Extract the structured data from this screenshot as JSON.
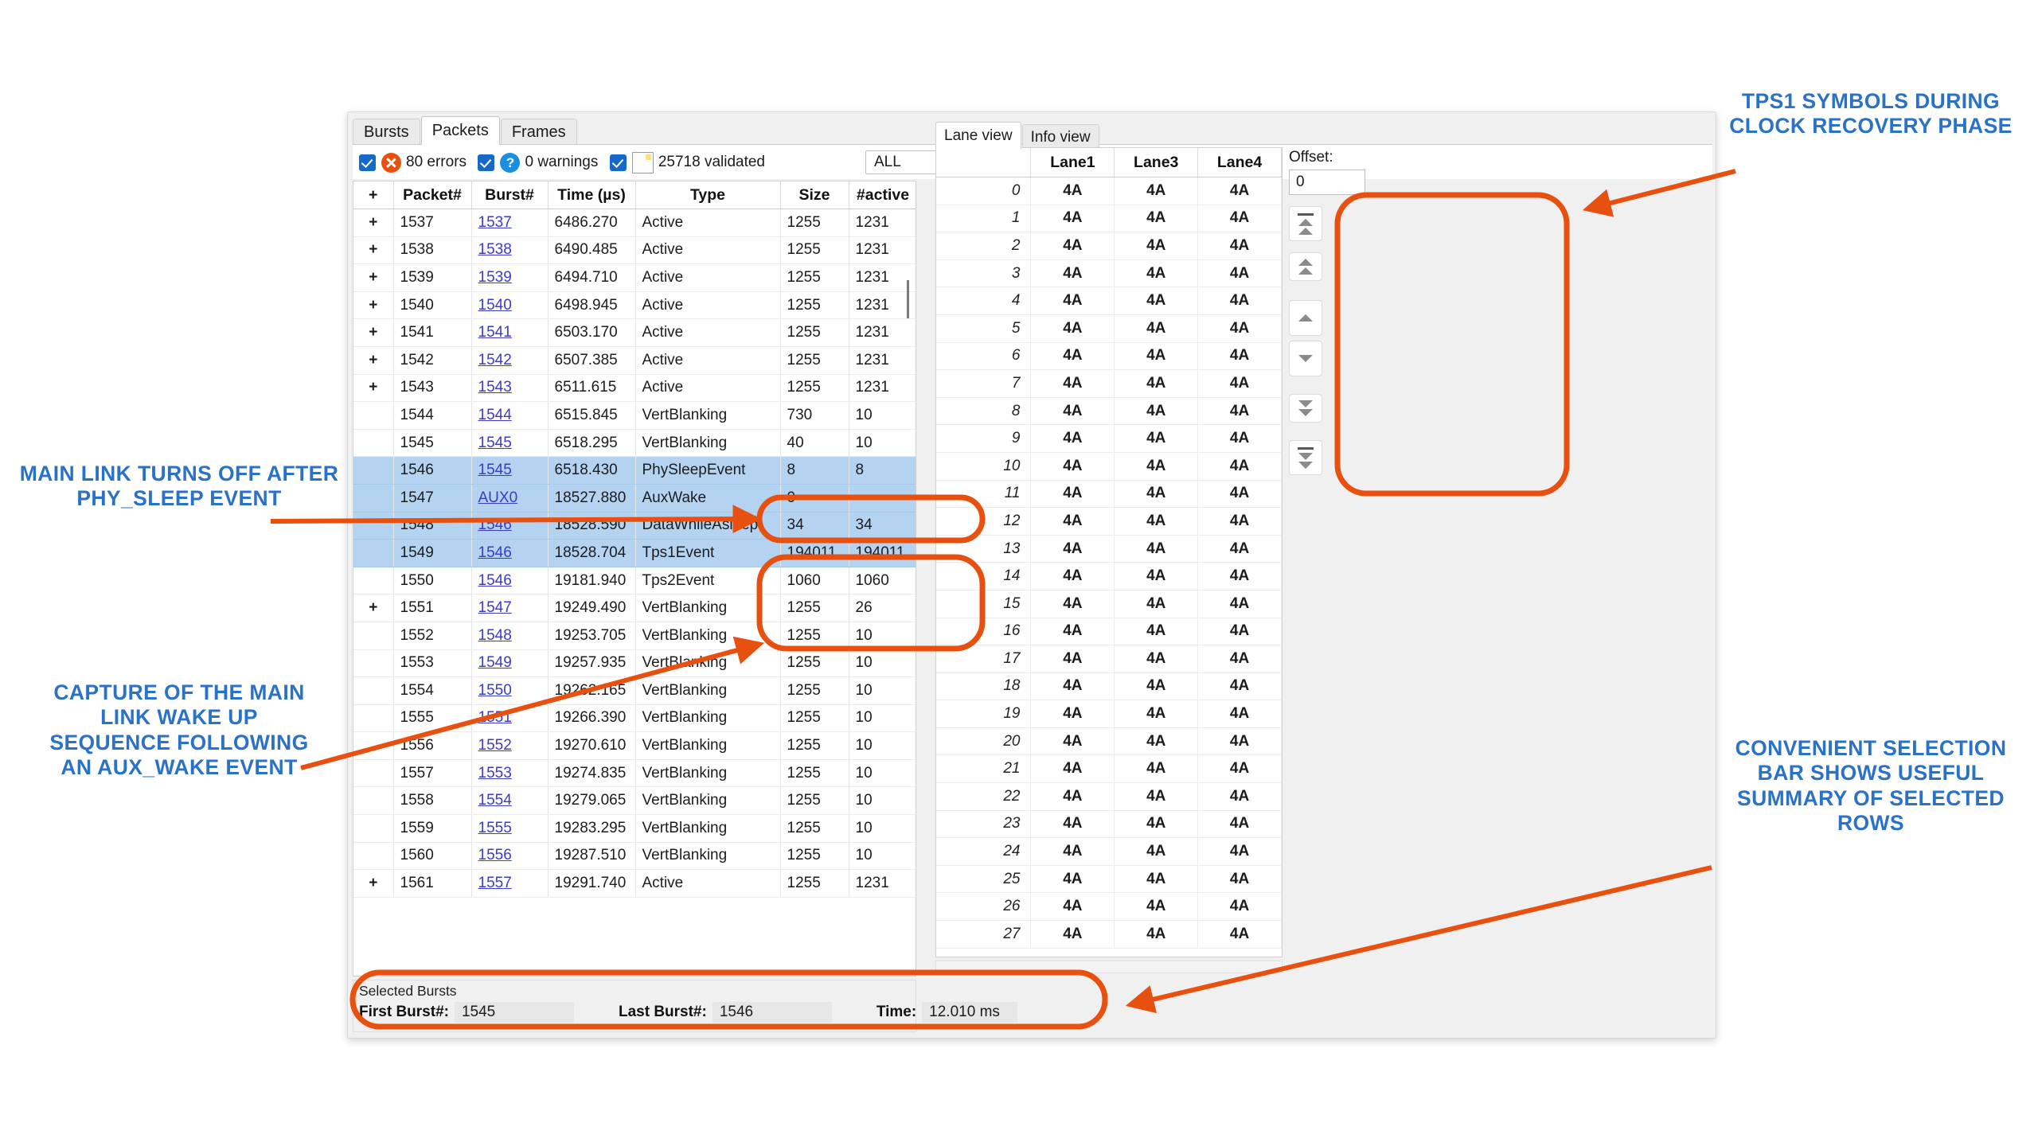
{
  "window": {
    "tabs": [
      {
        "label": "Bursts",
        "active": false
      },
      {
        "label": "Packets",
        "active": true
      },
      {
        "label": "Frames",
        "active": false
      }
    ]
  },
  "filter_bar": {
    "errors": {
      "label": "80 errors",
      "checked": true,
      "icon": "error-icon"
    },
    "warnings": {
      "label": "0 warnings",
      "checked": true,
      "icon": "question-icon"
    },
    "validated": {
      "label": "25718 validated",
      "checked": true,
      "icon": "note-icon"
    },
    "dropdown": {
      "value": "ALL"
    }
  },
  "packets_table": {
    "columns": [
      "+",
      "Packet#",
      "Burst#",
      "Time (µs)",
      "Type",
      "Size",
      "#active"
    ],
    "rows": [
      {
        "plus": "+",
        "packet": "1537",
        "burst": "1537",
        "time": "6486.270",
        "type": "Active",
        "size": "1255",
        "active": "1231",
        "selected": false
      },
      {
        "plus": "+",
        "packet": "1538",
        "burst": "1538",
        "time": "6490.485",
        "type": "Active",
        "size": "1255",
        "active": "1231",
        "selected": false
      },
      {
        "plus": "+",
        "packet": "1539",
        "burst": "1539",
        "time": "6494.710",
        "type": "Active",
        "size": "1255",
        "active": "1231",
        "selected": false
      },
      {
        "plus": "+",
        "packet": "1540",
        "burst": "1540",
        "time": "6498.945",
        "type": "Active",
        "size": "1255",
        "active": "1231",
        "selected": false
      },
      {
        "plus": "+",
        "packet": "1541",
        "burst": "1541",
        "time": "6503.170",
        "type": "Active",
        "size": "1255",
        "active": "1231",
        "selected": false
      },
      {
        "plus": "+",
        "packet": "1542",
        "burst": "1542",
        "time": "6507.385",
        "type": "Active",
        "size": "1255",
        "active": "1231",
        "selected": false
      },
      {
        "plus": "+",
        "packet": "1543",
        "burst": "1543",
        "time": "6511.615",
        "type": "Active",
        "size": "1255",
        "active": "1231",
        "selected": false
      },
      {
        "plus": "",
        "packet": "1544",
        "burst": "1544",
        "time": "6515.845",
        "type": "VertBlanking",
        "size": "730",
        "active": "10",
        "selected": false
      },
      {
        "plus": "",
        "packet": "1545",
        "burst": "1545",
        "time": "6518.295",
        "type": "VertBlanking",
        "size": "40",
        "active": "10",
        "selected": false
      },
      {
        "plus": "",
        "packet": "1546",
        "burst": "1545",
        "time": "6518.430",
        "type": "PhySleepEvent",
        "size": "8",
        "active": "8",
        "selected": true
      },
      {
        "plus": "",
        "packet": "1547",
        "burst": "AUX0",
        "time": "18527.880",
        "type": "AuxWake",
        "size": "0",
        "active": "",
        "selected": true
      },
      {
        "plus": "",
        "packet": "1548",
        "burst": "1546",
        "time": "18528.590",
        "type": "DataWhileAsleep",
        "size": "34",
        "active": "34",
        "selected": true
      },
      {
        "plus": "",
        "packet": "1549",
        "burst": "1546",
        "time": "18528.704",
        "type": "Tps1Event",
        "size": "194011",
        "active": "194011",
        "selected": true
      },
      {
        "plus": "",
        "packet": "1550",
        "burst": "1546",
        "time": "19181.940",
        "type": "Tps2Event",
        "size": "1060",
        "active": "1060",
        "selected": false
      },
      {
        "plus": "+",
        "packet": "1551",
        "burst": "1547",
        "time": "19249.490",
        "type": "VertBlanking",
        "size": "1255",
        "active": "26",
        "selected": false
      },
      {
        "plus": "",
        "packet": "1552",
        "burst": "1548",
        "time": "19253.705",
        "type": "VertBlanking",
        "size": "1255",
        "active": "10",
        "selected": false
      },
      {
        "plus": "",
        "packet": "1553",
        "burst": "1549",
        "time": "19257.935",
        "type": "VertBlanking",
        "size": "1255",
        "active": "10",
        "selected": false
      },
      {
        "plus": "",
        "packet": "1554",
        "burst": "1550",
        "time": "19262.165",
        "type": "VertBlanking",
        "size": "1255",
        "active": "10",
        "selected": false
      },
      {
        "plus": "",
        "packet": "1555",
        "burst": "1551",
        "time": "19266.390",
        "type": "VertBlanking",
        "size": "1255",
        "active": "10",
        "selected": false
      },
      {
        "plus": "",
        "packet": "1556",
        "burst": "1552",
        "time": "19270.610",
        "type": "VertBlanking",
        "size": "1255",
        "active": "10",
        "selected": false
      },
      {
        "plus": "",
        "packet": "1557",
        "burst": "1553",
        "time": "19274.835",
        "type": "VertBlanking",
        "size": "1255",
        "active": "10",
        "selected": false
      },
      {
        "plus": "",
        "packet": "1558",
        "burst": "1554",
        "time": "19279.065",
        "type": "VertBlanking",
        "size": "1255",
        "active": "10",
        "selected": false
      },
      {
        "plus": "",
        "packet": "1559",
        "burst": "1555",
        "time": "19283.295",
        "type": "VertBlanking",
        "size": "1255",
        "active": "10",
        "selected": false
      },
      {
        "plus": "",
        "packet": "1560",
        "burst": "1556",
        "time": "19287.510",
        "type": "VertBlanking",
        "size": "1255",
        "active": "10",
        "selected": false
      },
      {
        "plus": "+",
        "packet": "1561",
        "burst": "1557",
        "time": "19291.740",
        "type": "Active",
        "size": "1255",
        "active": "1231",
        "selected": false
      }
    ]
  },
  "selection_bar": {
    "title": "Selected Bursts",
    "first_burst_label": "First Burst#:",
    "first_burst_value": "1545",
    "last_burst_label": "Last Burst#:",
    "last_burst_value": "1546",
    "time_label": "Time:",
    "time_value": "12.010 ms"
  },
  "lane_panel": {
    "tabs": [
      {
        "label": "Lane view",
        "active": true
      },
      {
        "label": "Info view",
        "active": false
      }
    ],
    "columns": [
      "",
      "Lane1",
      "Lane3",
      "Lane4"
    ],
    "rows": [
      {
        "index": "0",
        "lane1": "4A",
        "lane3": "4A",
        "lane4": "4A"
      },
      {
        "index": "1",
        "lane1": "4A",
        "lane3": "4A",
        "lane4": "4A"
      },
      {
        "index": "2",
        "lane1": "4A",
        "lane3": "4A",
        "lane4": "4A"
      },
      {
        "index": "3",
        "lane1": "4A",
        "lane3": "4A",
        "lane4": "4A"
      },
      {
        "index": "4",
        "lane1": "4A",
        "lane3": "4A",
        "lane4": "4A"
      },
      {
        "index": "5",
        "lane1": "4A",
        "lane3": "4A",
        "lane4": "4A"
      },
      {
        "index": "6",
        "lane1": "4A",
        "lane3": "4A",
        "lane4": "4A"
      },
      {
        "index": "7",
        "lane1": "4A",
        "lane3": "4A",
        "lane4": "4A"
      },
      {
        "index": "8",
        "lane1": "4A",
        "lane3": "4A",
        "lane4": "4A"
      },
      {
        "index": "9",
        "lane1": "4A",
        "lane3": "4A",
        "lane4": "4A"
      },
      {
        "index": "10",
        "lane1": "4A",
        "lane3": "4A",
        "lane4": "4A"
      },
      {
        "index": "11",
        "lane1": "4A",
        "lane3": "4A",
        "lane4": "4A"
      },
      {
        "index": "12",
        "lane1": "4A",
        "lane3": "4A",
        "lane4": "4A"
      },
      {
        "index": "13",
        "lane1": "4A",
        "lane3": "4A",
        "lane4": "4A"
      },
      {
        "index": "14",
        "lane1": "4A",
        "lane3": "4A",
        "lane4": "4A"
      },
      {
        "index": "15",
        "lane1": "4A",
        "lane3": "4A",
        "lane4": "4A"
      },
      {
        "index": "16",
        "lane1": "4A",
        "lane3": "4A",
        "lane4": "4A"
      },
      {
        "index": "17",
        "lane1": "4A",
        "lane3": "4A",
        "lane4": "4A"
      },
      {
        "index": "18",
        "lane1": "4A",
        "lane3": "4A",
        "lane4": "4A"
      },
      {
        "index": "19",
        "lane1": "4A",
        "lane3": "4A",
        "lane4": "4A"
      },
      {
        "index": "20",
        "lane1": "4A",
        "lane3": "4A",
        "lane4": "4A"
      },
      {
        "index": "21",
        "lane1": "4A",
        "lane3": "4A",
        "lane4": "4A"
      },
      {
        "index": "22",
        "lane1": "4A",
        "lane3": "4A",
        "lane4": "4A"
      },
      {
        "index": "23",
        "lane1": "4A",
        "lane3": "4A",
        "lane4": "4A"
      },
      {
        "index": "24",
        "lane1": "4A",
        "lane3": "4A",
        "lane4": "4A"
      },
      {
        "index": "25",
        "lane1": "4A",
        "lane3": "4A",
        "lane4": "4A"
      },
      {
        "index": "26",
        "lane1": "4A",
        "lane3": "4A",
        "lane4": "4A"
      },
      {
        "index": "27",
        "lane1": "4A",
        "lane3": "4A",
        "lane4": "4A"
      }
    ],
    "offset": {
      "label": "Offset:",
      "value": "0"
    },
    "nav_buttons": [
      {
        "name": "first-button",
        "glyphs": "bar-up-up"
      },
      {
        "name": "page-up-button",
        "glyphs": "up-up"
      },
      {
        "name": "step-up-button",
        "glyphs": "up"
      },
      {
        "name": "step-down-button",
        "glyphs": "down"
      },
      {
        "name": "page-down-button",
        "glyphs": "down-down"
      },
      {
        "name": "last-button",
        "glyphs": "bar-down-down"
      }
    ]
  },
  "annotations": {
    "tps1": "TPS1 SYMBOLS DURING CLOCK RECOVERY PHASE",
    "main_link": "MAIN LINK TURNS OFF AFTER PHY_SLEEP EVENT",
    "capture": "CAPTURE OF THE MAIN LINK WAKE UP SEQUENCE FOLLOWING AN AUX_WAKE EVENT",
    "selection_bar": "CONVENIENT SELECTION BAR SHOWS USEFUL SUMMARY OF SELECTED ROWS"
  },
  "colors": {
    "annotation_blue": "#2a72c8",
    "callout_orange": "#e8500f",
    "selection_blue": "#b3d3f0",
    "link_blue": "#3b3bc8"
  }
}
